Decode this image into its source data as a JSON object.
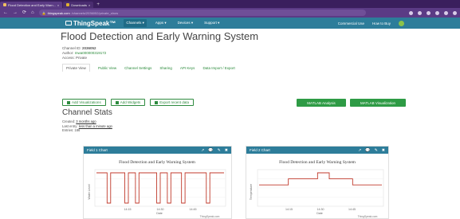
{
  "browser": {
    "tabs": [
      {
        "label": "Flood Detection and Early Warn...",
        "active": true
      },
      {
        "label": "Downloads",
        "active": false
      }
    ],
    "new_tab": "+",
    "url_domain": "thingspeak.com",
    "url_path": "/channels/2036052/private_show",
    "nav": {
      "back": "←",
      "forward": "→",
      "reload": "⟳",
      "home": "⌂"
    }
  },
  "ts_nav": {
    "logo": "ThingSpeak™",
    "items": [
      "Channels ▾",
      "Apps ▾",
      "Devices ▾",
      "Support ▾"
    ],
    "right": [
      "Commercial Use",
      "How to Buy"
    ]
  },
  "channel": {
    "title": "Flood Detection and Early Warning System",
    "id_label": "Channel ID:",
    "id_value": "2036052",
    "author_label": "Author:",
    "author_value": "mwa000000319172",
    "access": "Access: Private"
  },
  "tabs": [
    "Private View",
    "Public View",
    "Channel Settings",
    "Sharing",
    "API Keys",
    "Data Import / Export"
  ],
  "buttons": {
    "add_visualizations": "Add Visualizations",
    "add_widgets": "Add Widgets",
    "export_recent": "Export recent data",
    "matlab_analysis": "MATLAB Analysis",
    "matlab_visualization": "MATLAB Visualization"
  },
  "stats": {
    "title": "Channel Stats",
    "created_label": "Created:",
    "created_value": "3 months ago",
    "last_entry_label": "Last entry:",
    "last_entry_value": "less than a minute ago",
    "entries": "Entries: 186"
  },
  "charts": {
    "field1": {
      "header": "Field 1 Chart",
      "title": "Flood Detection and Early Warning System",
      "xlabel": "Date",
      "ylabel": "Water Level",
      "credit": "ThingSpeak.com",
      "ticks": [
        "14:15",
        "14:30",
        "14:45"
      ]
    },
    "field2": {
      "header": "Field 2 Chart",
      "title": "Flood Detection and Early Warning System",
      "xlabel": "Date",
      "ylabel": "Temperature",
      "credit": "ThingSpeak.com",
      "ticks": [
        "14:15",
        "14:30",
        "14:45"
      ]
    },
    "tools": [
      "↗",
      "💬",
      "✎",
      "✖"
    ]
  },
  "chart_data": [
    {
      "type": "line",
      "title": "Flood Detection and Early Warning System",
      "xlabel": "Date",
      "ylabel": "Water Level",
      "x_ticks": [
        "14:15",
        "14:30",
        "14:45"
      ],
      "ylim": [
        0,
        1
      ],
      "series": [
        {
          "values": [
            1,
            1,
            1,
            0,
            1,
            1,
            1,
            1,
            0,
            1,
            1,
            0,
            1,
            1,
            1,
            1,
            1,
            0,
            1,
            1,
            0,
            1,
            1,
            1,
            0,
            1,
            1,
            1,
            1,
            1,
            1,
            0,
            1,
            1,
            1,
            1,
            1
          ]
        }
      ]
    },
    {
      "type": "line",
      "title": "Flood Detection and Early Warning System",
      "xlabel": "Date",
      "ylabel": "Temperature",
      "x_ticks": [
        "14:15",
        "14:30",
        "14:45"
      ],
      "ylim": [
        0,
        1
      ],
      "series": [
        {
          "values": [
            0.6,
            0.6,
            0.6,
            0.6,
            0.6,
            0.8,
            0.8,
            0.8,
            0.8,
            0.8,
            1,
            1,
            0.8,
            0.8,
            0.8,
            0.8,
            0.6,
            0.6,
            0.6,
            0.6,
            0.6,
            0.6
          ]
        }
      ]
    }
  ],
  "colors": {
    "brand": "#2d7d9a",
    "line": "#c0392b",
    "green": "#2e9b45",
    "chrome": "#3a1f5d"
  }
}
